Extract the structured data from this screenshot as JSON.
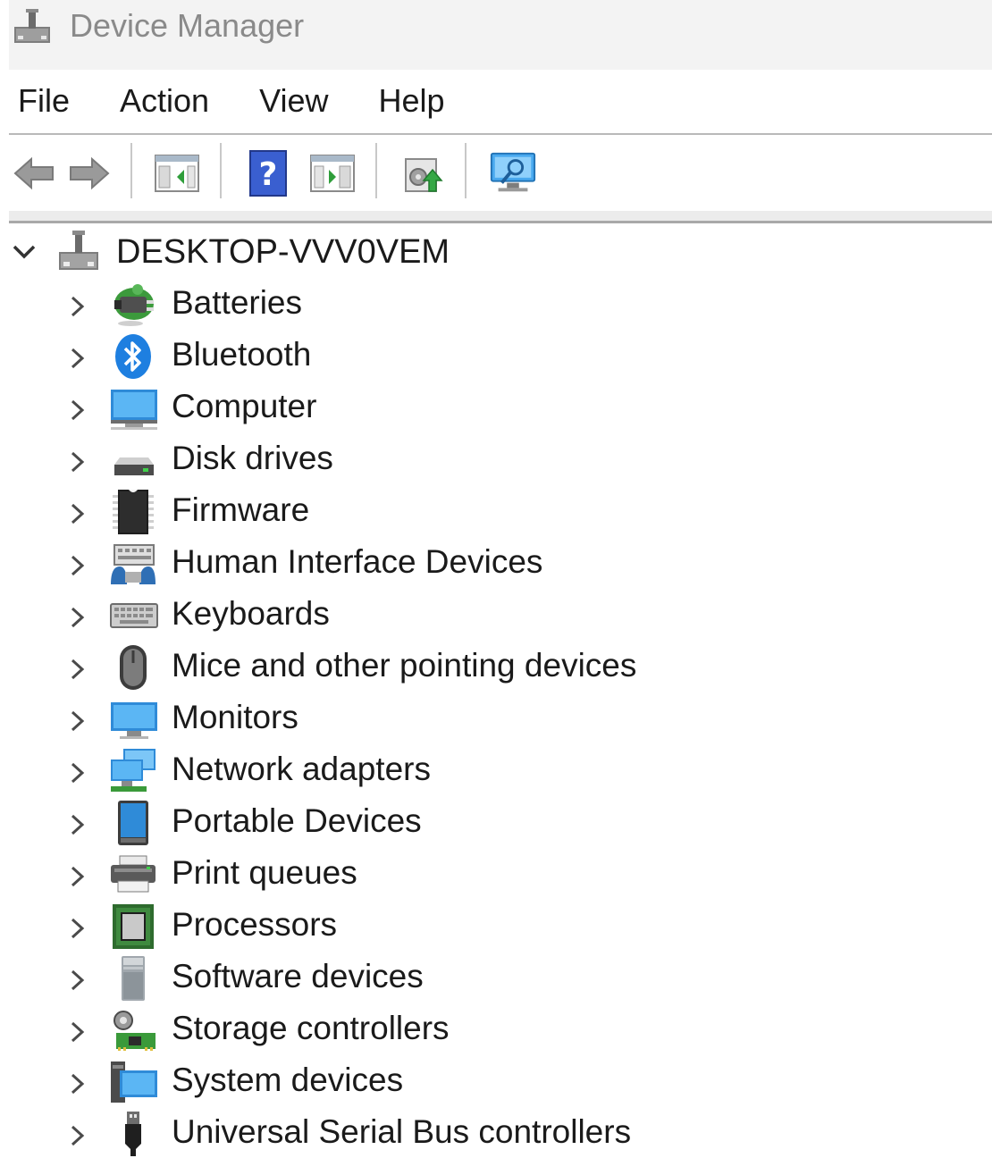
{
  "window": {
    "title": "Device Manager",
    "icon": "device-manager-icon"
  },
  "menu": [
    "File",
    "Action",
    "View",
    "Help"
  ],
  "toolbar": [
    {
      "name": "back-button",
      "icon": "back-arrow-icon"
    },
    {
      "name": "forward-button",
      "icon": "forward-arrow-icon"
    },
    {
      "name": "show-hide-console-tree-button",
      "icon": "console-tree-icon"
    },
    {
      "name": "help-button",
      "icon": "help-icon"
    },
    {
      "name": "show-hide-action-pane-button",
      "icon": "action-pane-icon"
    },
    {
      "name": "update-driver-button",
      "icon": "update-driver-icon"
    },
    {
      "name": "scan-hardware-button",
      "icon": "scan-hardware-icon"
    }
  ],
  "tree": {
    "root": {
      "label": "DESKTOP-VVV0VEM",
      "expanded": true,
      "icon": "computer-network-icon"
    },
    "nodes": [
      {
        "label": "Batteries",
        "icon": "battery-icon"
      },
      {
        "label": "Bluetooth",
        "icon": "bluetooth-icon"
      },
      {
        "label": "Computer",
        "icon": "computer-icon"
      },
      {
        "label": "Disk drives",
        "icon": "disk-drive-icon"
      },
      {
        "label": "Firmware",
        "icon": "firmware-chip-icon"
      },
      {
        "label": "Human Interface Devices",
        "icon": "hid-icon"
      },
      {
        "label": "Keyboards",
        "icon": "keyboard-icon"
      },
      {
        "label": "Mice and other pointing devices",
        "icon": "mouse-icon"
      },
      {
        "label": "Monitors",
        "icon": "monitor-icon"
      },
      {
        "label": "Network adapters",
        "icon": "network-adapter-icon"
      },
      {
        "label": "Portable Devices",
        "icon": "portable-device-icon"
      },
      {
        "label": "Print queues",
        "icon": "printer-icon"
      },
      {
        "label": "Processors",
        "icon": "processor-icon"
      },
      {
        "label": "Software devices",
        "icon": "software-device-icon"
      },
      {
        "label": "Storage controllers",
        "icon": "storage-controller-icon"
      },
      {
        "label": "System devices",
        "icon": "system-devices-icon"
      },
      {
        "label": "Universal Serial Bus controllers",
        "icon": "usb-icon"
      }
    ]
  },
  "colors": {
    "accent": "#2f8bd8",
    "monitor_blue": "#3aa0e6",
    "green": "#3a9a3a"
  }
}
